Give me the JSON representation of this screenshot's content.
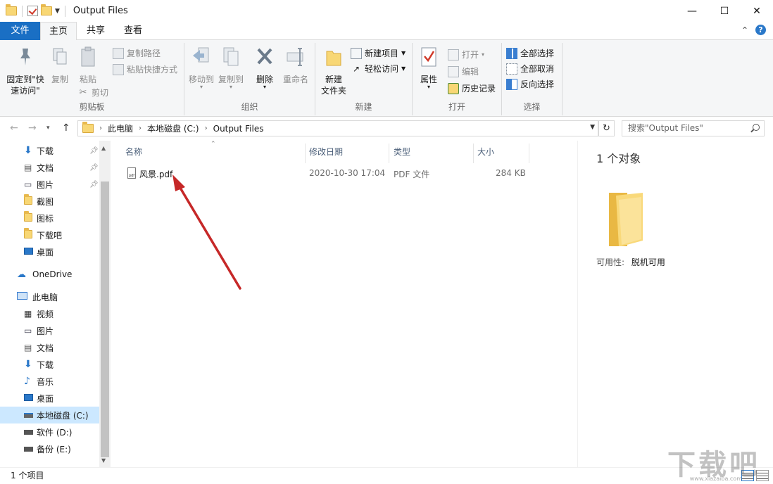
{
  "window": {
    "title": "Output Files",
    "minimize": "—",
    "maximize": "☐",
    "close": "✕"
  },
  "ribbon_tabs": [
    "文件",
    "主页",
    "共享",
    "查看"
  ],
  "ribbon": {
    "clipboard": {
      "label": "剪贴板",
      "pin_quick_access": "固定到\"快速访问\"",
      "copy": "复制",
      "paste": "粘贴",
      "copy_path": "复制路径",
      "paste_shortcut": "粘贴快捷方式",
      "cut": "剪切"
    },
    "organize": {
      "label": "组织",
      "move_to": "移动到",
      "copy_to": "复制到",
      "delete": "删除",
      "rename": "重命名"
    },
    "new": {
      "label": "新建",
      "new_folder": "新建\n文件夹",
      "new_item": "新建项目",
      "easy_access": "轻松访问"
    },
    "open": {
      "label": "打开",
      "properties": "属性",
      "open": "打开",
      "edit": "编辑",
      "history": "历史记录"
    },
    "select": {
      "label": "选择",
      "select_all": "全部选择",
      "select_none": "全部取消",
      "invert": "反向选择"
    }
  },
  "address": {
    "segments": [
      "此电脑",
      "本地磁盘 (C:)",
      "Output Files"
    ],
    "search_placeholder": "搜索\"Output Files\""
  },
  "nav": {
    "quick_access": [
      {
        "label": "下载",
        "icon": "download-icon",
        "pinned": true
      },
      {
        "label": "文档",
        "icon": "document-icon",
        "pinned": true
      },
      {
        "label": "图片",
        "icon": "picture-icon",
        "pinned": true
      },
      {
        "label": "截图",
        "icon": "folder-icon",
        "pinned": false
      },
      {
        "label": "图标",
        "icon": "folder-icon",
        "pinned": false
      },
      {
        "label": "下载吧",
        "icon": "folder-icon",
        "pinned": false
      },
      {
        "label": "桌面",
        "icon": "desktop-icon",
        "pinned": false
      }
    ],
    "onedrive": "OneDrive",
    "this_pc": "此电脑",
    "pc_items": [
      {
        "label": "视频",
        "icon": "video-icon"
      },
      {
        "label": "图片",
        "icon": "picture-icon"
      },
      {
        "label": "文档",
        "icon": "document-icon"
      },
      {
        "label": "下载",
        "icon": "download-icon"
      },
      {
        "label": "音乐",
        "icon": "music-icon"
      },
      {
        "label": "桌面",
        "icon": "desktop-icon"
      },
      {
        "label": "本地磁盘 (C:)",
        "icon": "drive-c-icon",
        "selected": true
      },
      {
        "label": "软件 (D:)",
        "icon": "drive-icon"
      },
      {
        "label": "备份 (E:)",
        "icon": "drive-icon"
      }
    ]
  },
  "columns": {
    "name": "名称",
    "modified": "修改日期",
    "type": "类型",
    "size": "大小"
  },
  "files": [
    {
      "name": "风景.pdf",
      "modified": "2020-10-30 17:04",
      "type": "PDF 文件",
      "size": "284 KB"
    }
  ],
  "preview": {
    "count": "1 个对象",
    "availability_label": "可用性:",
    "availability_value": "脱机可用"
  },
  "status": {
    "items": "1 个项目"
  },
  "watermark": {
    "text": "下载吧",
    "url": "www.xiazaiba.com"
  },
  "colors": {
    "accent": "#1a6fc4",
    "selected": "#cce8ff",
    "folder": "#f8d775",
    "arrow": "#c62828"
  }
}
